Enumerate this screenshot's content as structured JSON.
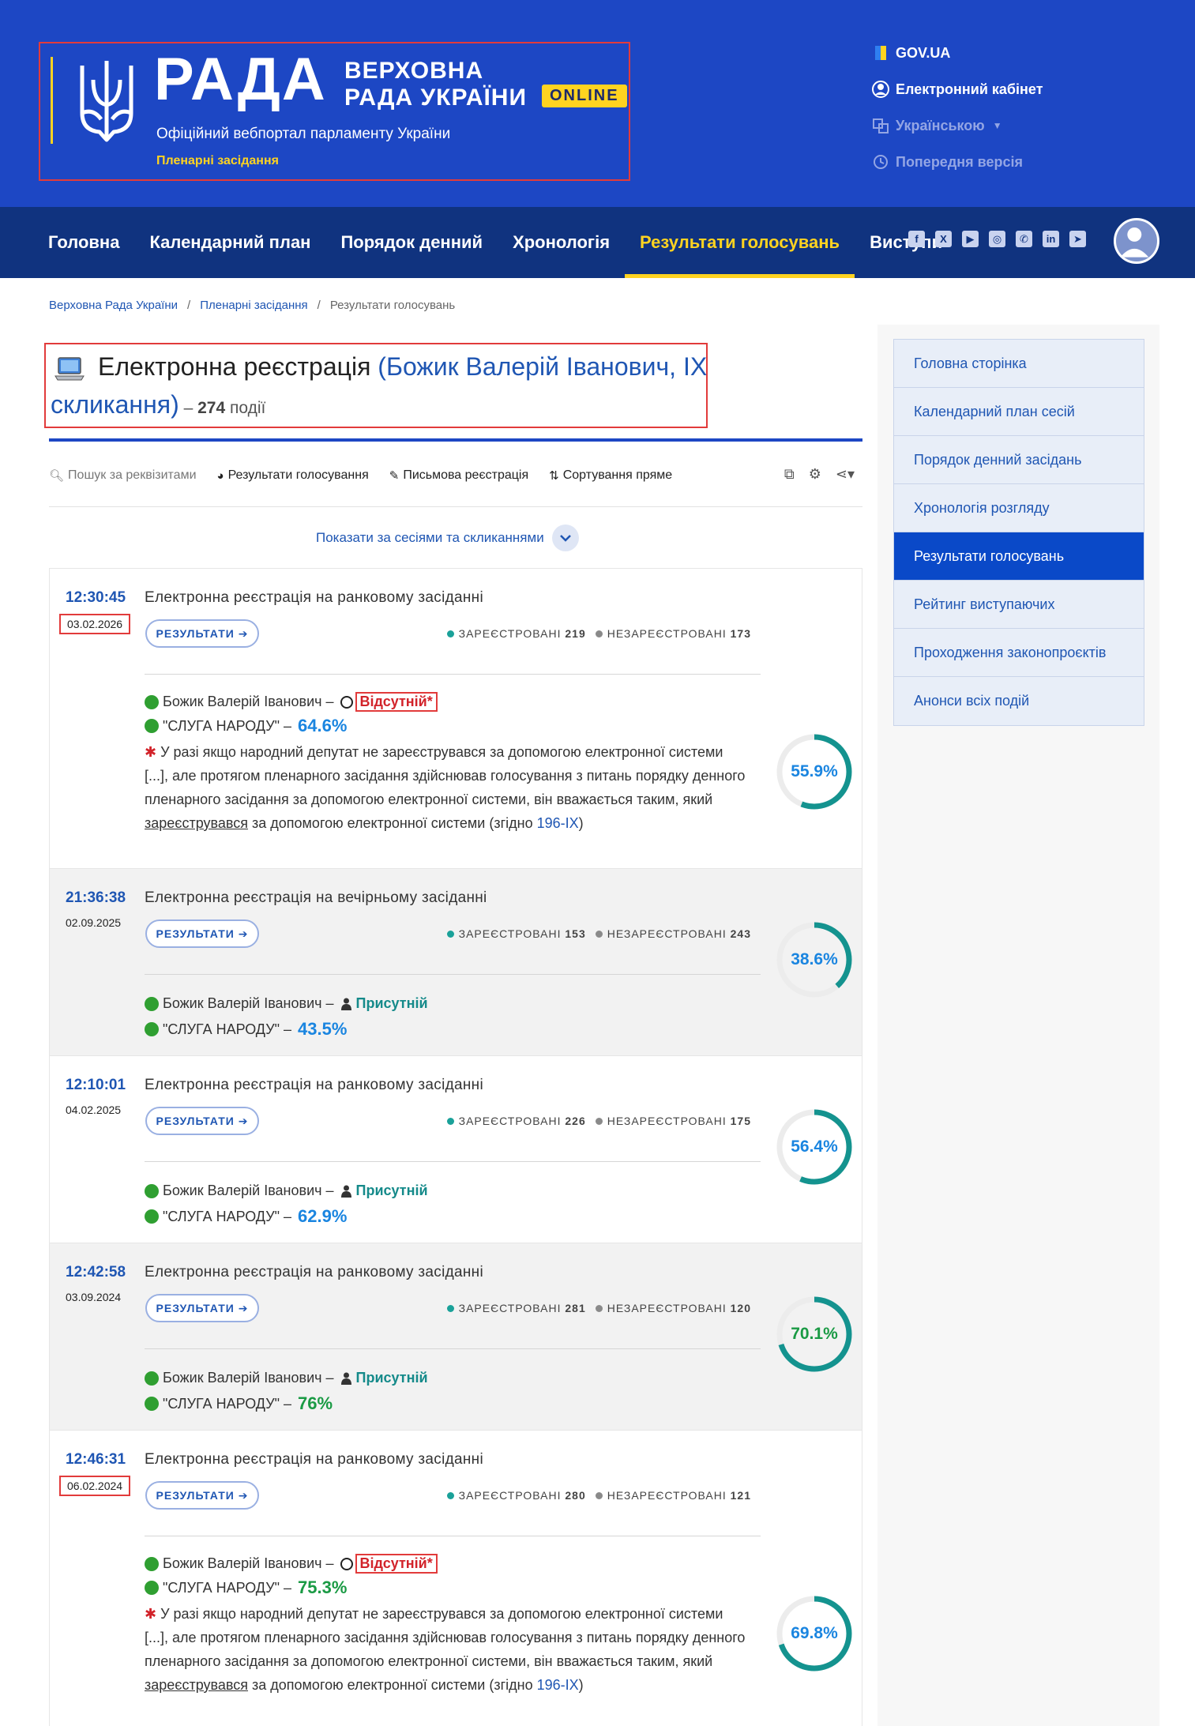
{
  "header": {
    "rada": "РАДА",
    "vr_line1": "ВЕРХОВНА",
    "vr_line2": "РАДА УКРАЇНИ",
    "online": "ONLINE",
    "tagline": "Офіційний вебпортал парламенту України",
    "section": "Пленарні засідання",
    "links": {
      "gov": "GOV.UA",
      "cabinet": "Електронний кабінет",
      "lang": "Українською",
      "prev": "Попередня версія"
    }
  },
  "nav": {
    "items": [
      "Головна",
      "Календарний план",
      "Порядок денний",
      "Хронологія",
      "Результати голосувань",
      "Виступи"
    ],
    "active_index": 4
  },
  "breadcrumbs": [
    "Верховна Рада України",
    "Пленарні засідання",
    "Результати голосувань"
  ],
  "page": {
    "title": "Електронна реєстрація",
    "person_open": "(Божик Валерій Іванович, IX",
    "person_close": "скликання)",
    "dash": " – ",
    "count": "274",
    "count_unit": " події"
  },
  "toolbar": {
    "search": "Пошук за реквізитами",
    "results": "Результати голосування",
    "written": "Письмова реєстрація",
    "sort": "Сортування пряме",
    "show_sessions": "Показати за сесіями та скликаннями"
  },
  "labels": {
    "results_btn": "РЕЗУЛЬТАТИ",
    "registered": "ЗАРЕЄСТРОВАНІ",
    "unregistered": "НЕЗАРЕЄСТРОВАНІ",
    "person": "Божик Валерій Іванович",
    "faction": "\"СЛУГА НАРОДУ\"",
    "absent": "Відсутній",
    "present": "Присутній",
    "note_1": "У разі якщо народний депутат не зареєструвався за допомогою електронної системи",
    "note_2": "[...], але протягом пленарного засідання здійснював голосування з питань порядку денного",
    "note_3": "пленарного засідання за допомогою електронної системи, він вважається таким, який",
    "note_4a": "зареєструвався",
    "note_4b": " за допомогою електронної системи (згідно ",
    "note_4c": "196-IX",
    "note_4d": ")"
  },
  "events": [
    {
      "time": "12:30:45",
      "date": "03.02.2026",
      "title": "Електронна реєстрація на ранковому засіданні",
      "registered": "219",
      "unregistered": "173",
      "status": "absent",
      "faction_pct": "64.6%",
      "faction_pct_color": "blue",
      "donut": "55.9%",
      "donut_value": 55.9,
      "donut_color": "blue"
    },
    {
      "time": "21:36:38",
      "date": "02.09.2025",
      "title": "Електронна реєстрація на вечірньому засіданні",
      "registered": "153",
      "unregistered": "243",
      "status": "present",
      "faction_pct": "43.5%",
      "faction_pct_color": "blue",
      "donut": "38.6%",
      "donut_value": 38.6,
      "donut_color": "blue"
    },
    {
      "time": "12:10:01",
      "date": "04.02.2025",
      "title": "Електронна реєстрація на ранковому засіданні",
      "registered": "226",
      "unregistered": "175",
      "status": "present",
      "faction_pct": "62.9%",
      "faction_pct_color": "blue",
      "donut": "56.4%",
      "donut_value": 56.4,
      "donut_color": "blue"
    },
    {
      "time": "12:42:58",
      "date": "03.09.2024",
      "title": "Електронна реєстрація на ранковому засіданні",
      "registered": "281",
      "unregistered": "120",
      "status": "present",
      "faction_pct": "76%",
      "faction_pct_color": "green",
      "donut": "70.1%",
      "donut_value": 70.1,
      "donut_color": "green"
    },
    {
      "time": "12:46:31",
      "date": "06.02.2024",
      "title": "Електронна реєстрація на ранковому засіданні",
      "registered": "280",
      "unregistered": "121",
      "status": "absent",
      "faction_pct": "75.3%",
      "faction_pct_color": "green",
      "donut": "69.8%",
      "donut_value": 69.8,
      "donut_color": "blue"
    }
  ],
  "sidebar": {
    "items": [
      "Головна сторінка",
      "Календарний план сесій",
      "Порядок денний засідань",
      "Хронологія розгляду",
      "Результати голосувань",
      "Рейтинг виступаючих",
      "Проходження законопроєктів",
      "Анонси всіх подій"
    ],
    "active_index": 4
  },
  "colors": {
    "header_bg": "#1d47c4",
    "nav_bg": "#10337f",
    "accent_yellow": "#ffd320",
    "link_blue": "#1f56b3",
    "ring_teal": "#14938f",
    "pct_blue": "#1a85e0",
    "pct_green": "#1a9a44"
  }
}
